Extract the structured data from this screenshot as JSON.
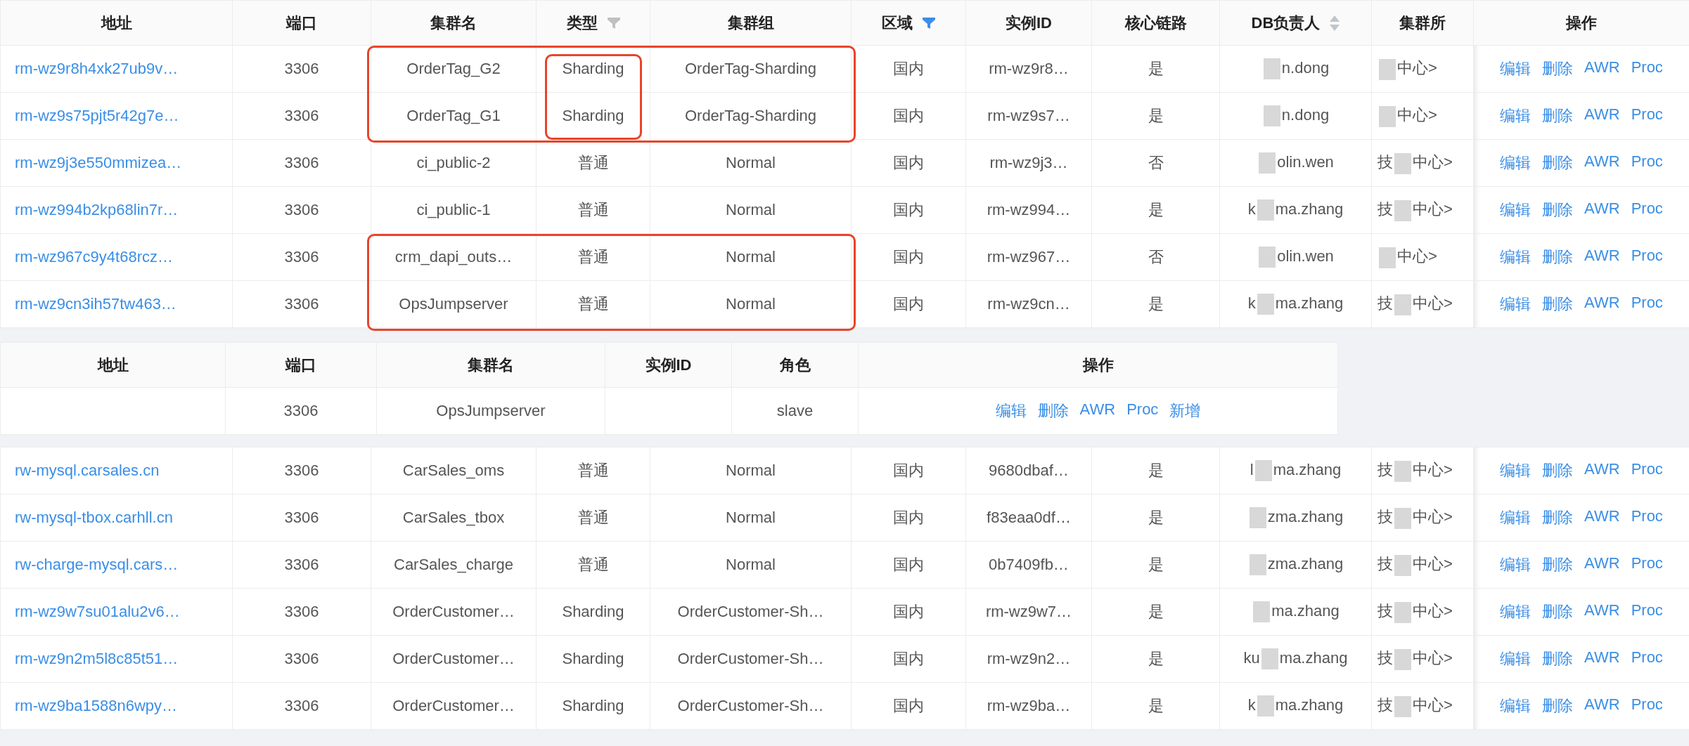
{
  "sections": [
    {
      "kind": "main",
      "columns": [
        {
          "label": "地址",
          "kind": "link"
        },
        {
          "label": "端口",
          "kind": "text"
        },
        {
          "label": "集群名",
          "kind": "text"
        },
        {
          "label": "类型",
          "kind": "text",
          "filterable": true,
          "filtered": false
        },
        {
          "label": "集群组",
          "kind": "text"
        },
        {
          "label": "区域",
          "kind": "text",
          "filterable": true,
          "filtered": true
        },
        {
          "label": "实例ID",
          "kind": "text"
        },
        {
          "label": "核心链路",
          "kind": "text"
        },
        {
          "label": "DB负责人",
          "kind": "owner",
          "sortable": true
        },
        {
          "label": "集群所",
          "kind": "dept"
        },
        {
          "label": "操作",
          "kind": "actions"
        }
      ],
      "rows": [
        [
          "rm-wz9r8h4xk27ub9v…",
          "3306",
          {
            "text": "OrderTag_G2",
            "outlined": true
          },
          {
            "text": "Sharding",
            "outlined": true,
            "tight_outline": true
          },
          {
            "text": "OrderTag-Sharding",
            "outlined": true
          },
          "国内",
          "rm-wz9r8…",
          "是",
          {
            "text": "n.dong"
          },
          {
            "rest": "中心>"
          },
          [
            "编辑",
            "删除",
            "AWR",
            "Proc"
          ]
        ],
        [
          "rm-wz9s75pjt5r42g7e…",
          "3306",
          {
            "text": "OrderTag_G1",
            "outlined": true
          },
          {
            "text": "Sharding",
            "outlined": true,
            "tight_outline": true
          },
          {
            "text": "OrderTag-Sharding",
            "outlined": true
          },
          "国内",
          "rm-wz9s7…",
          "是",
          {
            "text": "n.dong"
          },
          {
            "rest": "中心>"
          },
          [
            "编辑",
            "删除",
            "AWR",
            "Proc"
          ]
        ],
        [
          "rm-wz9j3e550mmizea…",
          "3306",
          "ci_public-2",
          "普通",
          "Normal",
          "国内",
          "rm-wz9j3…",
          "否",
          {
            "text": "olin.wen"
          },
          {
            "lead": "技",
            "rest": "中心>"
          },
          [
            "编辑",
            "删除",
            "AWR",
            "Proc"
          ]
        ],
        [
          "rm-wz994b2kp68lin7r…",
          "3306",
          "ci_public-1",
          "普通",
          "Normal",
          "国内",
          "rm-wz994…",
          "是",
          {
            "prefix": "k",
            "text": "ma.zhang"
          },
          {
            "lead": "技",
            "rest": "中心>"
          },
          [
            "编辑",
            "删除",
            "AWR",
            "Proc"
          ]
        ],
        [
          "rm-wz967c9y4t68rcz…",
          "3306",
          {
            "text": "crm_dapi_outs…",
            "outlined": true
          },
          {
            "text": "普通",
            "outlined": true
          },
          {
            "text": "Normal",
            "outlined": true
          },
          "国内",
          "rm-wz967…",
          "否",
          {
            "text": "olin.wen"
          },
          {
            "rest": "中心>"
          },
          [
            "编辑",
            "删除",
            "AWR",
            "Proc"
          ]
        ],
        [
          "rm-wz9cn3ih57tw463…",
          "3306",
          {
            "text": "OpsJumpserver",
            "outlined": true
          },
          {
            "text": "普通",
            "outlined": true
          },
          {
            "text": "Normal",
            "outlined": true
          },
          "国内",
          "rm-wz9cn…",
          "是",
          {
            "prefix": "k",
            "text": "ma.zhang"
          },
          {
            "lead": "技",
            "rest": "中心>"
          },
          [
            "编辑",
            "删除",
            "AWR",
            "Proc"
          ]
        ]
      ]
    },
    {
      "kind": "sub",
      "columns": [
        {
          "label": "地址",
          "kind": "text"
        },
        {
          "label": "端口",
          "kind": "text"
        },
        {
          "label": "集群名",
          "kind": "text"
        },
        {
          "label": "实例ID",
          "kind": "text"
        },
        {
          "label": "角色",
          "kind": "text"
        },
        {
          "label": "操作",
          "kind": "actions"
        }
      ],
      "rows": [
        [
          null,
          "3306",
          "OpsJumpserver",
          null,
          "slave",
          [
            "编辑",
            "删除",
            "AWR",
            "Proc",
            "新增"
          ]
        ]
      ]
    },
    {
      "kind": "main",
      "columns": [
        {
          "kind": "link"
        },
        {
          "kind": "text"
        },
        {
          "kind": "text"
        },
        {
          "kind": "text"
        },
        {
          "kind": "text"
        },
        {
          "kind": "text"
        },
        {
          "kind": "text"
        },
        {
          "kind": "text"
        },
        {
          "kind": "owner"
        },
        {
          "kind": "dept"
        },
        {
          "kind": "actions"
        }
      ],
      "rows": [
        [
          "rw-mysql.carsales.cn",
          "3306",
          "CarSales_oms",
          "普通",
          "Normal",
          "国内",
          "9680dbaf…",
          "是",
          {
            "prefix": "l",
            "text": "ma.zhang"
          },
          {
            "lead": "技",
            "rest": "中心>"
          },
          [
            "编辑",
            "删除",
            "AWR",
            "Proc"
          ]
        ],
        [
          "rw-mysql-tbox.carhll.cn",
          "3306",
          "CarSales_tbox",
          "普通",
          "Normal",
          "国内",
          "f83eaa0df…",
          "是",
          {
            "text": "zma.zhang"
          },
          {
            "lead": "技",
            "rest": "中心>"
          },
          [
            "编辑",
            "删除",
            "AWR",
            "Proc"
          ]
        ],
        [
          "rw-charge-mysql.cars…",
          "3306",
          "CarSales_charge",
          "普通",
          "Normal",
          "国内",
          "0b7409fb…",
          "是",
          {
            "text": "zma.zhang"
          },
          {
            "lead": "技",
            "rest": "中心>"
          },
          [
            "编辑",
            "删除",
            "AWR",
            "Proc"
          ]
        ],
        [
          "rm-wz9w7su01alu2v6…",
          "3306",
          "OrderCustomer…",
          "Sharding",
          "OrderCustomer-Sh…",
          "国内",
          "rm-wz9w7…",
          "是",
          {
            "text": "ma.zhang"
          },
          {
            "lead": "技",
            "rest": "中心>"
          },
          [
            "编辑",
            "删除",
            "AWR",
            "Proc"
          ]
        ],
        [
          "rm-wz9n2m5l8c85t51…",
          "3306",
          "OrderCustomer…",
          "Sharding",
          "OrderCustomer-Sh…",
          "国内",
          "rm-wz9n2…",
          "是",
          {
            "prefix": "ku",
            "text": "ma.zhang"
          },
          {
            "lead": "技",
            "rest": "中心>"
          },
          [
            "编辑",
            "删除",
            "AWR",
            "Proc"
          ]
        ],
        [
          "rm-wz9ba1588n6wpy…",
          "3306",
          "OrderCustomer…",
          "Sharding",
          "OrderCustomer-Sh…",
          "国内",
          "rm-wz9ba…",
          "是",
          {
            "prefix": "k",
            "text": "ma.zhang"
          },
          {
            "lead": "技",
            "rest": "中心>"
          },
          [
            "编辑",
            "删除",
            "AWR",
            "Proc"
          ]
        ]
      ]
    }
  ]
}
